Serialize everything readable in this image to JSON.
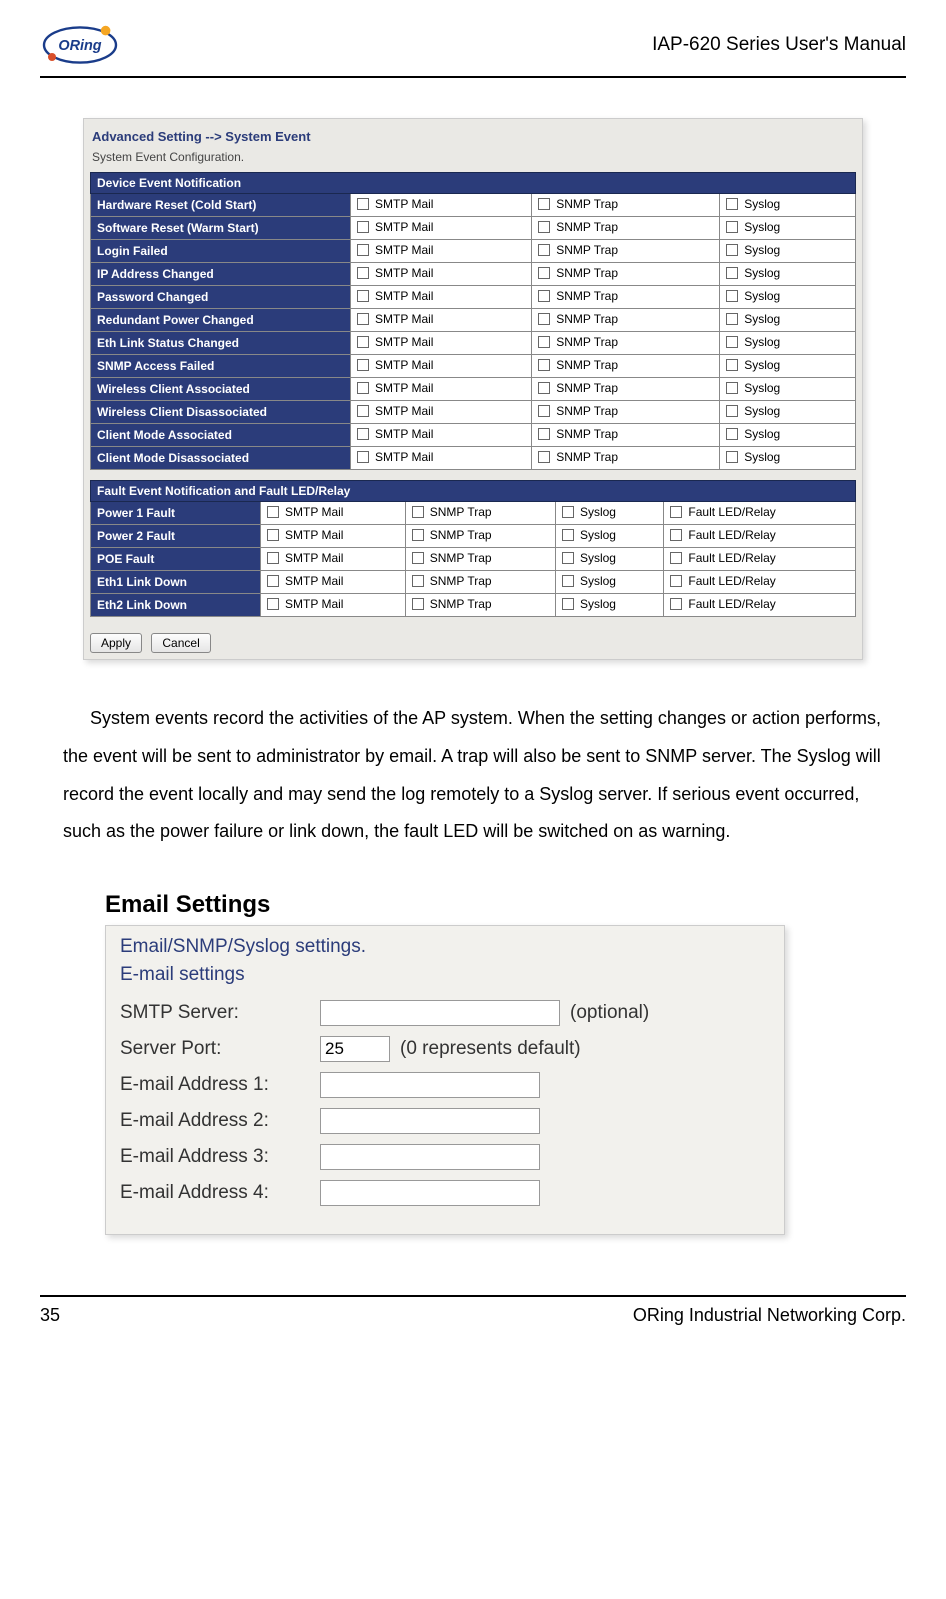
{
  "header": {
    "title": "IAP-620 Series User's Manual"
  },
  "s1": {
    "breadcrumb": "Advanced Setting --> System Event",
    "subtitle": "System Event Configuration.",
    "table1_header": "Device Event Notification",
    "opts3": [
      "SMTP Mail",
      "SNMP Trap",
      "Syslog"
    ],
    "events": [
      "Hardware Reset (Cold Start)",
      "Software Reset (Warm Start)",
      "Login Failed",
      "IP Address Changed",
      "Password Changed",
      "Redundant Power Changed",
      "Eth Link Status Changed",
      "SNMP Access Failed",
      "Wireless Client Associated",
      "Wireless Client Disassociated",
      "Client Mode Associated",
      "Client Mode Disassociated"
    ],
    "table2_header": "Fault Event Notification and Fault LED/Relay",
    "opts4": [
      "SMTP Mail",
      "SNMP Trap",
      "Syslog",
      "Fault LED/Relay"
    ],
    "faults": [
      "Power 1 Fault",
      "Power 2 Fault",
      "POE Fault",
      "Eth1 Link Down",
      "Eth2 Link Down"
    ],
    "apply": "Apply",
    "cancel": "Cancel"
  },
  "paragraph": "System events record the activities of the AP system.    When the setting changes or action performs, the event will be sent to administrator by email.    A trap will also be sent to SNMP server. The Syslog will record the event locally and may send the log remotely to a Syslog server.    If serious event occurred, such as the power failure or link down, the fault LED will be switched on as warning.",
  "h2": "Email Settings",
  "s2": {
    "title": "Email/SNMP/Syslog settings.",
    "sub": "E-mail settings",
    "rows": {
      "smtp": "SMTP Server:",
      "smtp_note": "(optional)",
      "port": "Server Port:",
      "port_val": "25",
      "port_note": "(0 represents default)",
      "e1": "E-mail Address 1:",
      "e2": "E-mail Address 2:",
      "e3": "E-mail Address 3:",
      "e4": "E-mail Address 4:"
    }
  },
  "footer": {
    "page": "35",
    "company": "ORing Industrial Networking Corp."
  }
}
